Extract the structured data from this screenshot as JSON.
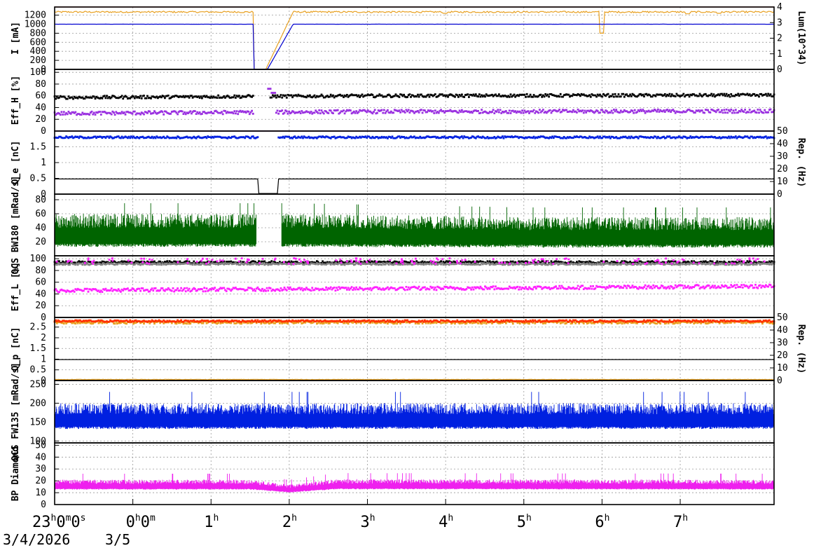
{
  "chart_data": {
    "type": "line",
    "x_unit": "hours after 23:00 on 3/4/2026",
    "x_range": [
      0,
      9.2
    ],
    "time_axis": {
      "labels": [
        {
          "x": 0,
          "main": "23",
          "parts": [
            [
              "h",
              "0"
            ],
            [
              "m",
              "0"
            ],
            [
              "s",
              ""
            ]
          ],
          "text": "23h0m0s"
        },
        {
          "x": 1,
          "main": "0",
          "parts": [
            [
              "h",
              "0"
            ],
            [
              "m",
              ""
            ]
          ],
          "text": "0h0m"
        },
        {
          "x": 2,
          "main": "1",
          "parts": [
            [
              "h",
              ""
            ]
          ],
          "text": "1h"
        },
        {
          "x": 3,
          "main": "2",
          "parts": [
            [
              "h",
              ""
            ]
          ],
          "text": "2h"
        },
        {
          "x": 4,
          "main": "3",
          "parts": [
            [
              "h",
              ""
            ]
          ],
          "text": "3h"
        },
        {
          "x": 5,
          "main": "4",
          "parts": [
            [
              "h",
              ""
            ]
          ],
          "text": "4h"
        },
        {
          "x": 6,
          "main": "5",
          "parts": [
            [
              "h",
              ""
            ]
          ],
          "text": "5h"
        },
        {
          "x": 7,
          "main": "6",
          "parts": [
            [
              "h",
              ""
            ]
          ],
          "text": "6h"
        },
        {
          "x": 8,
          "main": "7",
          "parts": [
            [
              "h",
              ""
            ]
          ],
          "text": "7h"
        }
      ],
      "dates": [
        {
          "x": 0,
          "text": "3/4/2026"
        },
        {
          "x": 1,
          "text": "3/5"
        }
      ]
    },
    "panels": [
      {
        "id": "current",
        "ylabel": "I [mA]",
        "yticks": [
          "0",
          "200",
          "400",
          "600",
          "800",
          "1000",
          "1200"
        ],
        "ylim": [
          0,
          1380
        ],
        "right": {
          "label": "Lum(10^34)",
          "yticks": [
            "0",
            "1",
            "2",
            "3",
            "4"
          ],
          "ylim": [
            0,
            4
          ]
        },
        "series": [
          {
            "color": "#e8a020",
            "style": "line",
            "level": 1270,
            "noise": 18,
            "gaps": [
              [
                2.55,
                3.0
              ]
            ],
            "ramp": [
              2.7,
              3.05,
              1270
            ],
            "dips": [
              [
                7.0,
                800
              ],
              [
                5.0,
                1240
              ],
              [
                8.1,
                1230
              ],
              [
                8.5,
                1240
              ]
            ]
          },
          {
            "color": "#0000d0",
            "style": "line",
            "level": 1000,
            "noise": 1,
            "gaps": [
              [
                2.55,
                3.0
              ]
            ],
            "ramp": [
              2.72,
              3.05,
              1000
            ],
            "steps": [
              2.35,
              1010
            ]
          },
          {
            "color": "#d00000",
            "style": "line",
            "level": 1380,
            "noise": 0
          }
        ]
      },
      {
        "id": "eff_h",
        "ylabel": "Eff_H [%]",
        "yticks": [
          "0",
          "20",
          "40",
          "60",
          "80",
          "100"
        ],
        "ylim": [
          0,
          105
        ],
        "series": [
          {
            "color": "#000000",
            "style": "dots",
            "level": 58,
            "noise": 2.5,
            "gaps": [
              [
                2.55,
                2.75
              ]
            ],
            "drift": [
              [
                0,
                57
              ],
              [
                4,
                60
              ],
              [
                9.2,
                61
              ]
            ]
          },
          {
            "color": "#9a30e0",
            "style": "dots",
            "level": 32,
            "noise": 3,
            "gaps": [
              [
                2.55,
                2.72
              ]
            ],
            "drift": [
              [
                0,
                30
              ],
              [
                4,
                33
              ],
              [
                9.2,
                34
              ]
            ],
            "spikes": [
              [
                2.7,
                75
              ],
              [
                2.75,
                72
              ],
              [
                2.8,
                65
              ]
            ]
          }
        ]
      },
      {
        "id": "qe",
        "ylabel": "Q_e [nC]",
        "yticks": [
          "0",
          "0.5",
          "1",
          "1.5"
        ],
        "ylim": [
          0,
          2.0
        ],
        "right": {
          "label": "Rep. (Hz)",
          "yticks": [
            "0",
            "10",
            "20",
            "30",
            "40",
            "50"
          ],
          "ylim": [
            0,
            50
          ]
        },
        "series": [
          {
            "color": "#0020e0",
            "style": "dots",
            "level": 1.8,
            "noise": 0.03,
            "gaps": [
              [
                2.6,
                2.85
              ]
            ]
          },
          {
            "color": "#000000",
            "style": "line",
            "level": 0.48,
            "noise": 0,
            "gaps": [],
            "notch": [
              2.6,
              2.85,
              0.02
            ]
          },
          {
            "color": "#c020c0",
            "style": "line",
            "level": 2.05,
            "noise": 0
          }
        ]
      },
      {
        "id": "qcs_bw180",
        "ylabel": "QCS BW180 [mRad/s]",
        "yticks": [
          "20",
          "40",
          "60",
          "80"
        ],
        "ylim": [
          0,
          88
        ],
        "series": [
          {
            "color": "#006400",
            "style": "band",
            "low": 15,
            "high": 60,
            "spike": 75,
            "gaps": [
              [
                2.58,
                2.9
              ]
            ],
            "drift": [
              [
                0,
                1
              ],
              [
                3,
                1
              ],
              [
                6,
                0.92
              ],
              [
                9.2,
                0.92
              ]
            ]
          }
        ]
      },
      {
        "id": "eff_l",
        "ylabel": "Eff_L [%]",
        "yticks": [
          "0",
          "20",
          "40",
          "60",
          "80",
          "100"
        ],
        "ylim": [
          0,
          105
        ],
        "series": [
          {
            "color": "#000000",
            "style": "dots",
            "level": 94,
            "noise": 2,
            "gaps": []
          },
          {
            "color": "#808080",
            "style": "dots",
            "level": 91,
            "noise": 1.5,
            "gaps": []
          },
          {
            "color": "#ff20ff",
            "style": "dots",
            "level": 47,
            "noise": 3,
            "gaps": [],
            "drift": [
              [
                0,
                46
              ],
              [
                4,
                49
              ],
              [
                9.2,
                53
              ]
            ]
          },
          {
            "color": "#ff20ff",
            "style": "scatter",
            "level": 96,
            "noise": 5,
            "gaps": []
          }
        ]
      },
      {
        "id": "qp",
        "ylabel": "Q_p [nC]",
        "yticks": [
          "0",
          "0.5",
          "1",
          "1.5",
          "2",
          "2.5"
        ],
        "ylim": [
          0,
          2.95
        ],
        "right": {
          "label": "Rep. (Hz)",
          "yticks": [
            "0",
            "10",
            "20",
            "30",
            "40",
            "50"
          ],
          "ylim": [
            0,
            50
          ]
        },
        "series": [
          {
            "color": "#e8a020",
            "style": "dots",
            "level": 2.72,
            "noise": 0.06,
            "gaps": []
          },
          {
            "color": "#ff3000",
            "style": "dots",
            "level": 2.78,
            "noise": 0.04,
            "gaps": []
          },
          {
            "color": "#000000",
            "style": "line",
            "level": 0.98,
            "noise": 0,
            "gaps": []
          },
          {
            "color": "#e8a020",
            "style": "line",
            "level": 0.05,
            "noise": 0.01,
            "gaps": []
          }
        ]
      },
      {
        "id": "qcs_fw135",
        "ylabel": "QCS FW135 [mRad/s]",
        "yticks": [
          "100",
          "150",
          "200",
          "250"
        ],
        "ylim": [
          95,
          260
        ],
        "series": [
          {
            "color": "#0020e0",
            "style": "band",
            "low": 135,
            "high": 200,
            "spike": 230,
            "gaps": []
          }
        ]
      },
      {
        "id": "bp_diamond",
        "ylabel": "BP Diamond",
        "yticks": [
          "0",
          "10",
          "20",
          "30",
          "40",
          "50"
        ],
        "ylim": [
          0,
          52
        ],
        "series": [
          {
            "color": "#ee20ee",
            "style": "band",
            "low": 13,
            "high": 21,
            "spike": 26,
            "gaps": [],
            "drift": [
              [
                0,
                1
              ],
              [
                2.5,
                1
              ],
              [
                3.0,
                0.8
              ],
              [
                3.6,
                1.02
              ],
              [
                9.2,
                1
              ]
            ]
          }
        ]
      }
    ]
  }
}
